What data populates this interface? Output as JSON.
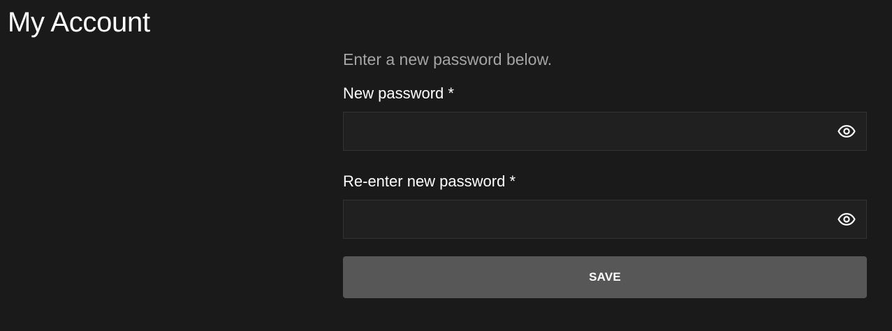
{
  "page": {
    "title": "My Account"
  },
  "form": {
    "intro": "Enter a new password below.",
    "new_password": {
      "label": "New password *",
      "value": "",
      "toggle_icon": "eye-icon"
    },
    "confirm_password": {
      "label": "Re-enter new password *",
      "value": "",
      "toggle_icon": "eye-icon"
    },
    "save_label": "SAVE"
  },
  "colors": {
    "background": "#1a1a1a",
    "input_background": "#202020",
    "input_border": "#333333",
    "button_background": "#575757",
    "muted_text": "#a5a5a5",
    "text": "#ffffff"
  }
}
